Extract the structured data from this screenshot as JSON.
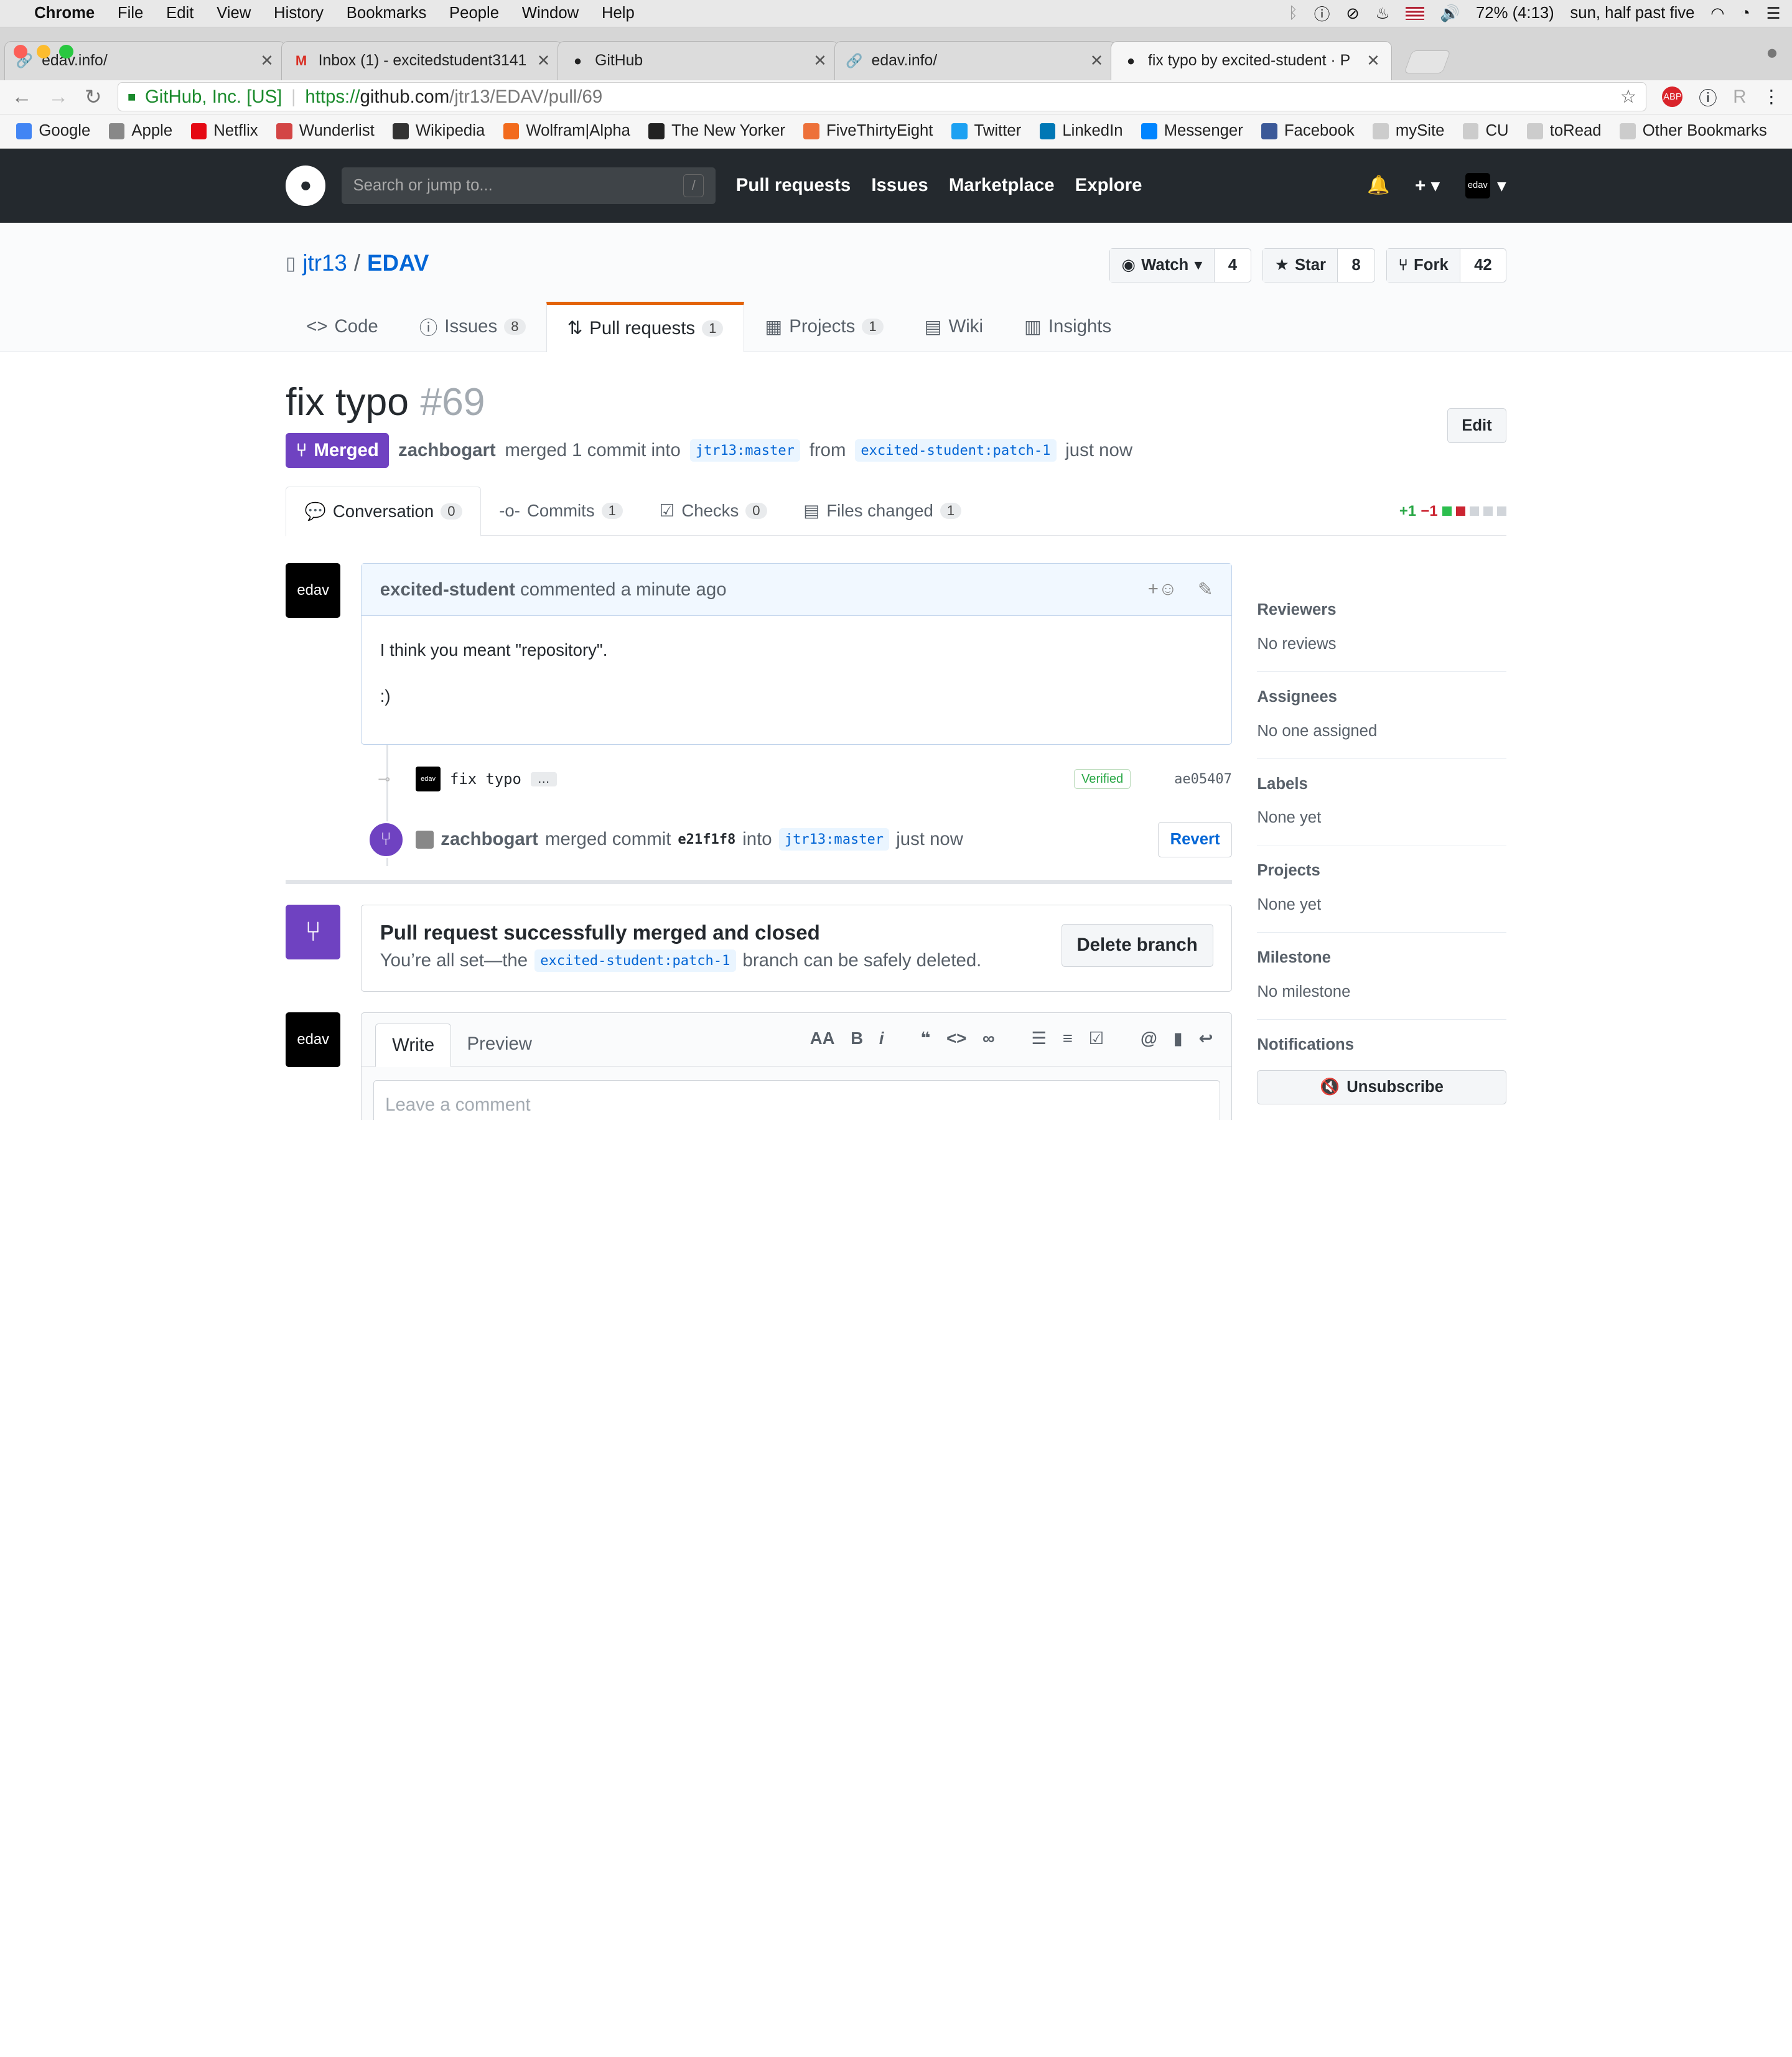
{
  "mac": {
    "app": "Chrome",
    "menus": [
      "File",
      "Edit",
      "View",
      "History",
      "Bookmarks",
      "People",
      "Window",
      "Help"
    ],
    "battery": "72% (4:13)",
    "time": "sun, half past five"
  },
  "tabs": [
    {
      "title": "edav.info/"
    },
    {
      "title": "Inbox (1) - excitedstudent3141"
    },
    {
      "title": "GitHub"
    },
    {
      "title": "edav.info/"
    },
    {
      "title": "fix typo by excited-student · P"
    }
  ],
  "address": {
    "secure": "GitHub, Inc. [US]",
    "url_prefix": "https://",
    "url_host": "github.com",
    "url_path": "/jtr13/EDAV/pull/69"
  },
  "bookmarks": [
    {
      "label": "Google",
      "color": "#4285f4"
    },
    {
      "label": "Apple",
      "color": "#888"
    },
    {
      "label": "Netflix",
      "color": "#e50914"
    },
    {
      "label": "Wunderlist",
      "color": "#d34545"
    },
    {
      "label": "Wikipedia",
      "color": "#333"
    },
    {
      "label": "Wolfram|Alpha",
      "color": "#f26b1d"
    },
    {
      "label": "The New Yorker",
      "color": "#222"
    },
    {
      "label": "FiveThirtyEight",
      "color": "#ed713a"
    },
    {
      "label": "Twitter",
      "color": "#1da1f2"
    },
    {
      "label": "LinkedIn",
      "color": "#0077b5"
    },
    {
      "label": "Messenger",
      "color": "#0084ff"
    },
    {
      "label": "Facebook",
      "color": "#3b5998"
    },
    {
      "label": "mySite",
      "color": "#ccc"
    },
    {
      "label": "CU",
      "color": "#ccc"
    },
    {
      "label": "toRead",
      "color": "#ccc"
    },
    {
      "label": "Other Bookmarks",
      "color": "#ccc"
    }
  ],
  "gh": {
    "search": "Search or jump to...",
    "slash": "/",
    "nav": [
      "Pull requests",
      "Issues",
      "Marketplace",
      "Explore"
    ],
    "avatar": "edav"
  },
  "repo": {
    "owner": "jtr13",
    "sep": "/",
    "name": "EDAV",
    "watch": "Watch",
    "watch_count": "4",
    "star": "Star",
    "star_count": "8",
    "fork": "Fork",
    "fork_count": "42"
  },
  "repotabs": [
    {
      "label": "Code",
      "icon": "<>"
    },
    {
      "label": "Issues",
      "count": "8",
      "icon": "ⓘ"
    },
    {
      "label": "Pull requests",
      "count": "1",
      "icon": "⇅"
    },
    {
      "label": "Projects",
      "count": "1",
      "icon": "▦"
    },
    {
      "label": "Wiki",
      "icon": "▤"
    },
    {
      "label": "Insights",
      "icon": "▥"
    }
  ],
  "pr": {
    "title": "fix typo",
    "number": "#69",
    "edit": "Edit",
    "state": "Merged",
    "author": "zachbogart",
    "merged_text": "merged 1 commit into",
    "base": "jtr13:master",
    "from": "from",
    "head": "excited-student:patch-1",
    "when": "just now"
  },
  "prtabs": [
    {
      "label": "Conversation",
      "count": "0"
    },
    {
      "label": "Commits",
      "count": "1"
    },
    {
      "label": "Checks",
      "count": "0"
    },
    {
      "label": "Files changed",
      "count": "1"
    }
  ],
  "diffstat": {
    "add": "+1",
    "del": "−1"
  },
  "comment": {
    "avatar": "edav",
    "author": "excited-student",
    "action": "commented",
    "when": "a minute ago",
    "lines": [
      "I think you meant \"repository\".",
      ":)"
    ]
  },
  "commit": {
    "avatar": "edav",
    "message": "fix typo",
    "dots": "…",
    "verified": "Verified",
    "sha": "ae05407"
  },
  "mergeevent": {
    "user": "zachbogart",
    "text": "merged commit",
    "sha": "e21f1f8",
    "into": "into",
    "branch": "jtr13:master",
    "when": "just now",
    "revert": "Revert"
  },
  "mergebox": {
    "title": "Pull request successfully merged and closed",
    "pre": "You’re all set—the",
    "branch": "excited-student:patch-1",
    "post": "branch can be safely deleted.",
    "delete": "Delete branch"
  },
  "compose": {
    "avatar": "edav",
    "write": "Write",
    "preview": "Preview",
    "placeholder": "Leave a comment"
  },
  "sidebar": [
    {
      "h": "Reviewers",
      "v": "No reviews"
    },
    {
      "h": "Assignees",
      "v": "No one assigned"
    },
    {
      "h": "Labels",
      "v": "None yet"
    },
    {
      "h": "Projects",
      "v": "None yet"
    },
    {
      "h": "Milestone",
      "v": "No milestone"
    }
  ],
  "notifications": {
    "h": "Notifications",
    "button": "Unsubscribe"
  }
}
